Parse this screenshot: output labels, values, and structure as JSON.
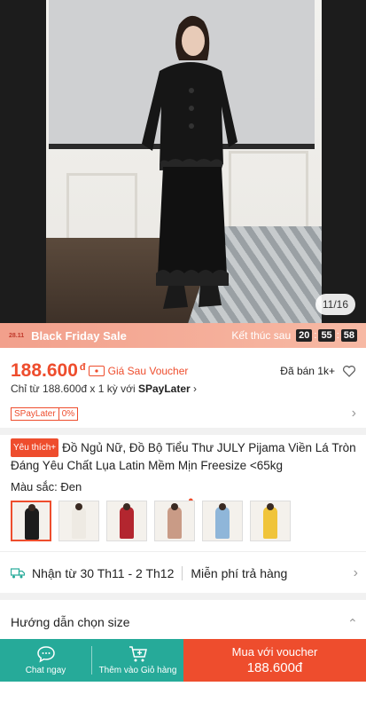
{
  "hero": {
    "image_counter": "11/16"
  },
  "flash_sale": {
    "badge": "28.11",
    "title": "Black Friday Sale",
    "ends_label": "Kết thúc sau",
    "hours": "20",
    "minutes": "55",
    "seconds": "58"
  },
  "price": {
    "amount": "188.600",
    "currency": "đ",
    "voucher_note": "Giá Sau Voucher",
    "sold": "Đã bán 1k+"
  },
  "installment": {
    "prefix": "Chỉ từ 188.600đ x 1 kỳ với ",
    "provider": "SPayLater",
    "chevron": "›"
  },
  "spaylater": {
    "label": "SPayLater",
    "rate": "0%"
  },
  "product": {
    "favorite_badge": "Yêu thích+",
    "title": "Đồ Ngủ Nữ, Đồ Bộ Tiểu Thư JULY Pijama Viền Lá Tròn Đáng Yêu Chất Lụa Latin Mềm Mịn Freesize <65kg"
  },
  "variants": {
    "label": "Màu sắc: Đen",
    "options": [
      {
        "color": "#1c1c1c"
      },
      {
        "color": "#eeeae3"
      },
      {
        "color": "#b3262f"
      },
      {
        "color": "#c99b86"
      },
      {
        "color": "#8fb6d9"
      },
      {
        "color": "#f0c43a"
      }
    ]
  },
  "shipping": {
    "delivery": "Nhận từ 30 Th11 - 2 Th12",
    "returns": "Miễn phí trả hàng"
  },
  "size_guide": {
    "label": "Hướng dẫn chọn size"
  },
  "bottom_bar": {
    "chat_label": "Chat ngay",
    "cart_label": "Thêm vào Giỏ hàng",
    "buy_label": "Mua với voucher",
    "buy_price": "188.600đ"
  },
  "colors": {
    "accent": "#ee4d2d",
    "teal": "#26aa99"
  }
}
